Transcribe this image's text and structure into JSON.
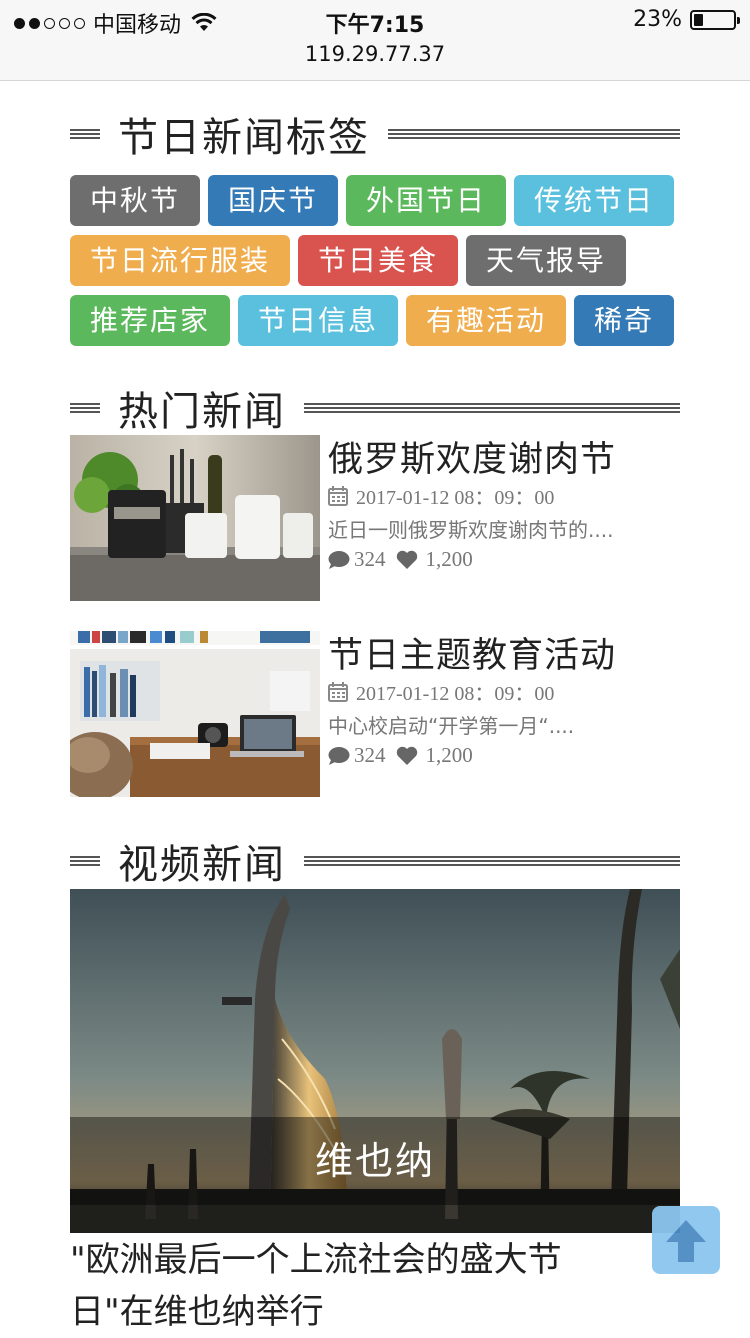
{
  "status_bar": {
    "carrier": "中国移动",
    "time": "下午7:15",
    "url": "119.29.77.37",
    "battery": "23%",
    "battery_level": 0.23,
    "signal_bars": 2
  },
  "tags_section": {
    "title": "节日新闻标签",
    "tags": [
      {
        "label": "中秋节",
        "color": "#6e6e6e"
      },
      {
        "label": "国庆节",
        "color": "#337ab7"
      },
      {
        "label": "外国节日",
        "color": "#5cb85c"
      },
      {
        "label": "传统节日",
        "color": "#5bc0de"
      },
      {
        "label": "节日流行服装",
        "color": "#f0ad4e"
      },
      {
        "label": "节日美食",
        "color": "#d9534f"
      },
      {
        "label": "天气报导",
        "color": "#6e6e6e"
      },
      {
        "label": "推荐店家",
        "color": "#5cb85c"
      },
      {
        "label": "节日信息",
        "color": "#5bc0de"
      },
      {
        "label": "有趣活动",
        "color": "#f0ad4e"
      },
      {
        "label": "稀奇",
        "color": "#337ab7"
      }
    ]
  },
  "hot_section": {
    "title": "热门新闻",
    "items": [
      {
        "title": "俄罗斯欢度谢肉节",
        "date": "2017-01-12 08：09：00",
        "summary": "近日一则俄罗斯欢度谢肉节的....",
        "comments": "324",
        "likes": "1,200"
      },
      {
        "title": "节日主题教育活动",
        "date": "2017-01-12 08：09：00",
        "summary": "中心校启动“开学第一月“....",
        "comments": "324",
        "likes": "1,200"
      }
    ]
  },
  "video_section": {
    "title": "视频新闻",
    "caption": "维也纳",
    "headline": "\"欧洲最后一个上流社会的盛大节日\"在维也纳举行"
  },
  "icons": {
    "calendar": "calendar-icon",
    "comment": "comment-icon",
    "heart": "heart-icon",
    "back_to_top": "arrow-up-icon"
  }
}
